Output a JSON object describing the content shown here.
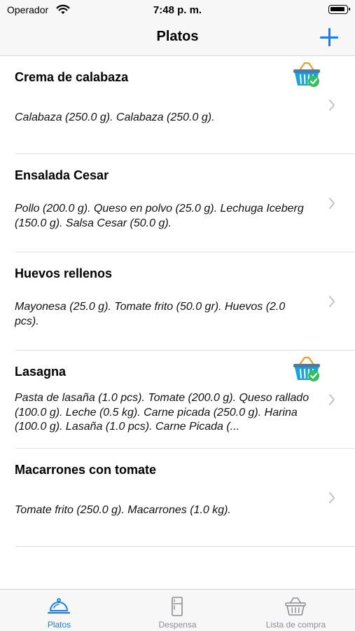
{
  "status_bar": {
    "carrier": "Operador",
    "time": "7:48 p. m."
  },
  "nav": {
    "title": "Platos",
    "add_icon": "plus-icon"
  },
  "colors": {
    "accent": "#1a7cf5",
    "inactive": "#8e8e93",
    "basket_blue": "#1aa3d9",
    "check_green": "#2fc25b"
  },
  "dishes": [
    {
      "name": "Crema de calabaza",
      "ingredients": "Calabaza (250.0 g). Calabaza (250.0 g).",
      "in_shopping_list": true
    },
    {
      "name": "Ensalada Cesar",
      "ingredients": "Pollo (200.0 g). Queso en polvo (25.0 g). Lechuga Iceberg (150.0 g). Salsa Cesar (50.0 g).",
      "in_shopping_list": false
    },
    {
      "name": "Huevos rellenos",
      "ingredients": "Mayonesa (25.0 g). Tomate frito (50.0 gr). Huevos (2.0 pcs).",
      "in_shopping_list": false
    },
    {
      "name": "Lasagna",
      "ingredients": "Pasta de lasaña (1.0 pcs). Tomate (200.0 g). Queso rallado (100.0 g). Leche (0.5 kg). Carne picada (250.0 g). Harina (100.0 g). Lasaña (1.0 pcs). Carne Picada (...",
      "in_shopping_list": true
    },
    {
      "name": "Macarrones con tomate",
      "ingredients": "Tomate frito (250.0 g). Macarrones (1.0 kg).",
      "in_shopping_list": false
    }
  ],
  "tabs": [
    {
      "label": "Platos",
      "icon": "cloche-icon",
      "active": true
    },
    {
      "label": "Despensa",
      "icon": "fridge-icon",
      "active": false
    },
    {
      "label": "Lista de compra",
      "icon": "basket-icon",
      "active": false
    }
  ]
}
